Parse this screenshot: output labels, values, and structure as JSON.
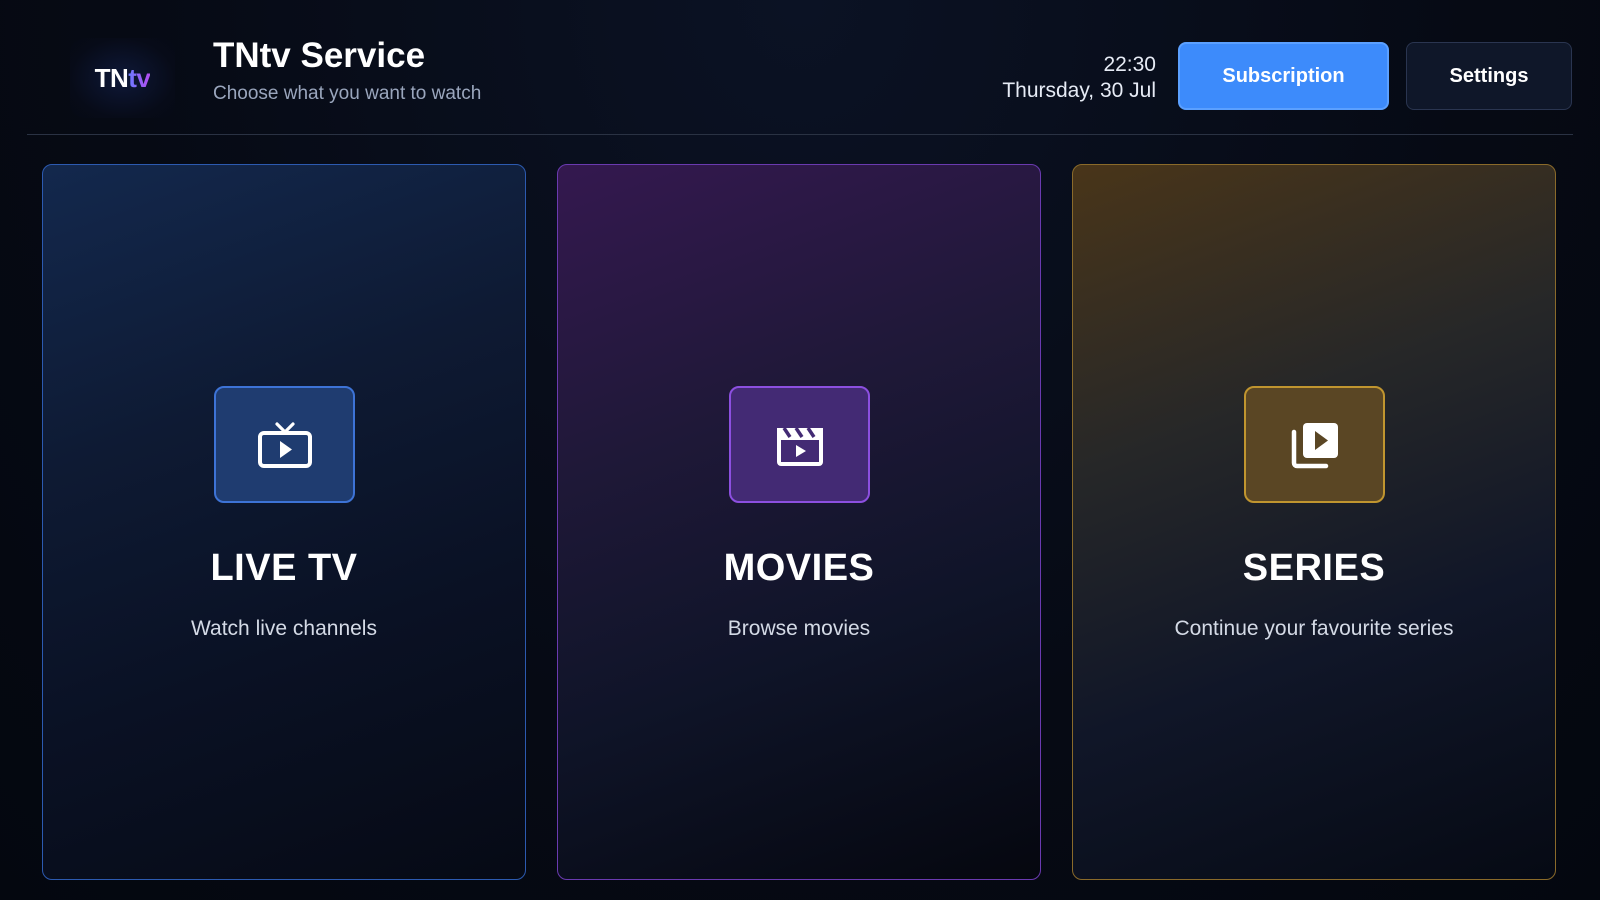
{
  "app": {
    "logo": {
      "part1": "TN",
      "part2": "tv"
    },
    "title": "TNtv Service",
    "subtitle": "Choose what you want to watch"
  },
  "clock": {
    "time": "22:30",
    "date": "Thursday, 30 Jul"
  },
  "header": {
    "subscription_label": "Subscription",
    "settings_label": "Settings"
  },
  "cards": [
    {
      "title": "LIVE TV",
      "description": "Watch live channels",
      "icon": "tv-play-icon",
      "accent": "#3d73d6"
    },
    {
      "title": "MOVIES",
      "description": "Browse movies",
      "icon": "clapperboard-icon",
      "accent": "#8c4fe0"
    },
    {
      "title": "SERIES",
      "description": "Continue your favourite series",
      "icon": "video-library-icon",
      "accent": "#c0952f"
    }
  ],
  "colors": {
    "primary_button": "#3d8bfb",
    "background": "#060a14"
  }
}
